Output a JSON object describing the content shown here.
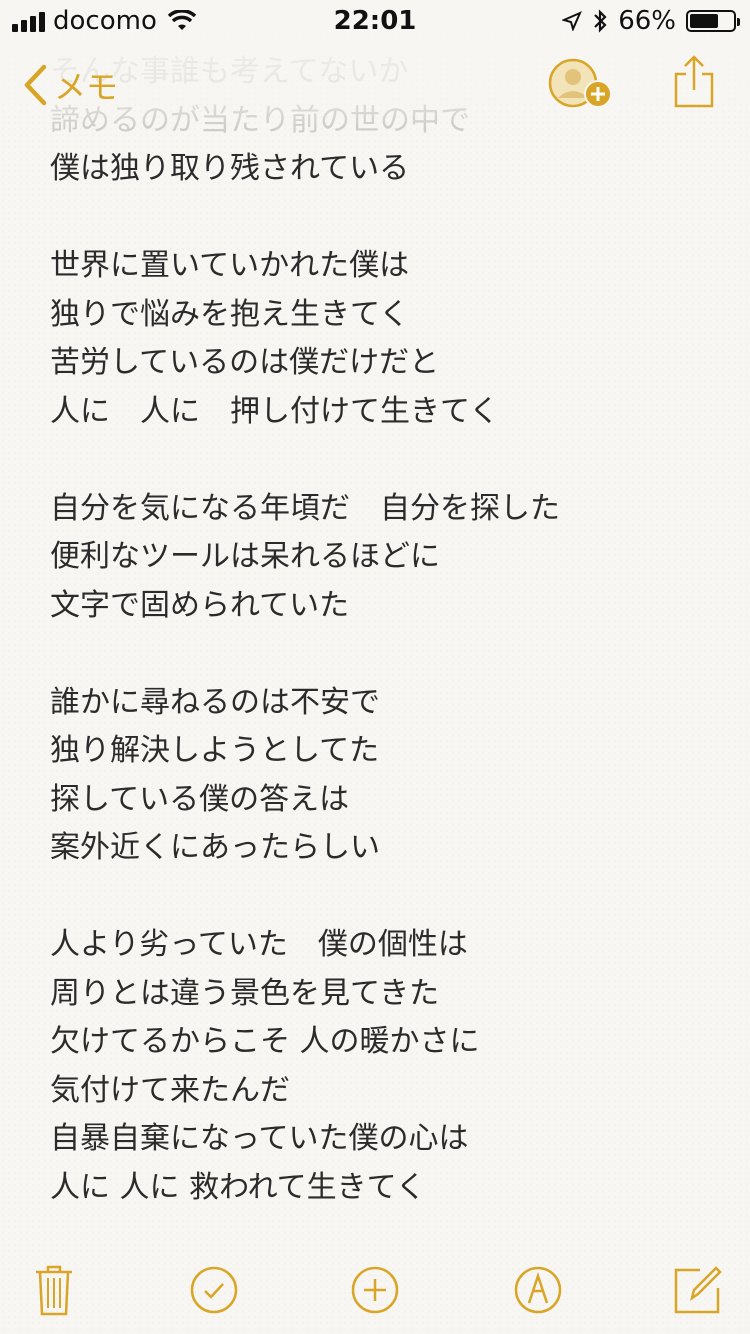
{
  "status_bar": {
    "carrier": "docomo",
    "time": "22:01",
    "battery_percent": "66%",
    "battery_level": 0.66
  },
  "nav": {
    "back_label": "メモ"
  },
  "note": {
    "faded_lines": [
      "そんな事誰も考えてないか",
      "諦めるのが当たり前の世の中で"
    ],
    "lines": [
      "僕は独り取り残されている",
      "",
      "世界に置いていかれた僕は",
      "独りで悩みを抱え生きてく",
      "苦労しているのは僕だけだと",
      "人に　人に　押し付けて生きてく",
      "",
      "自分を気になる年頃だ　自分を探した",
      "便利なツールは呆れるほどに",
      "文字で固められていた",
      "",
      "誰かに尋ねるのは不安で",
      "独り解決しようとしてた",
      "探している僕の答えは",
      "案外近くにあったらしい",
      "",
      "人より劣っていた　僕の個性は",
      "周りとは違う景色を見てきた",
      "欠けてるからこそ 人の暖かさに",
      "気付けて来たんだ",
      "自暴自棄になっていた僕の心は",
      "人に 人に 救われて生きてく"
    ]
  },
  "colors": {
    "accent": "#d9a526",
    "text": "#2b2b2b",
    "paper": "#f7f6f3"
  },
  "toolbar": {
    "icons": [
      "trash-icon",
      "checklist-icon",
      "add-icon",
      "sketch-icon",
      "compose-icon"
    ]
  }
}
